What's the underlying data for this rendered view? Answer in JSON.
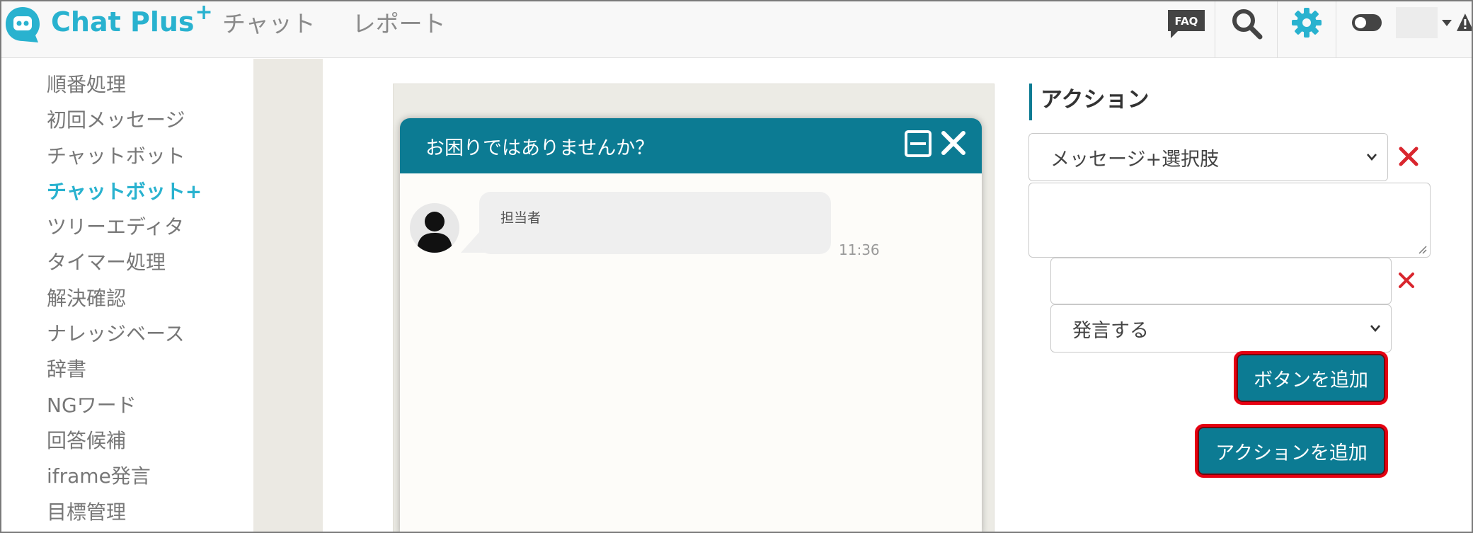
{
  "header": {
    "logo_text": "Chat Plus",
    "logo_plus": "+",
    "nav": [
      "チャット",
      "レポート"
    ],
    "faq_label": "FAQ"
  },
  "colors": {
    "brand": "#29b2cf",
    "primary": "#0c7b93",
    "highlight": "#e60012",
    "delete": "#d9262e"
  },
  "sidebar": {
    "items": [
      {
        "label": "順番処理"
      },
      {
        "label": "初回メッセージ"
      },
      {
        "label": "チャットボット"
      },
      {
        "label": "チャットボット+",
        "active": true
      },
      {
        "label": "ツリーエディタ"
      },
      {
        "label": "タイマー処理"
      },
      {
        "label": "解決確認"
      },
      {
        "label": "ナレッジベース"
      },
      {
        "label": "辞書"
      },
      {
        "label": "NGワード"
      },
      {
        "label": "回答候補"
      },
      {
        "label": "iframe発言"
      },
      {
        "label": "目標管理"
      }
    ]
  },
  "widget": {
    "title": "お困りではありませんか？",
    "message": {
      "sender": "担当者",
      "time": "11:36"
    }
  },
  "action_panel": {
    "title": "アクション",
    "action_type": "メッセージ+選択肢",
    "message_text": "",
    "button_label_value": "",
    "button_behavior": "発言する",
    "add_button_label": "ボタンを追加",
    "add_action_label": "アクションを追加"
  }
}
